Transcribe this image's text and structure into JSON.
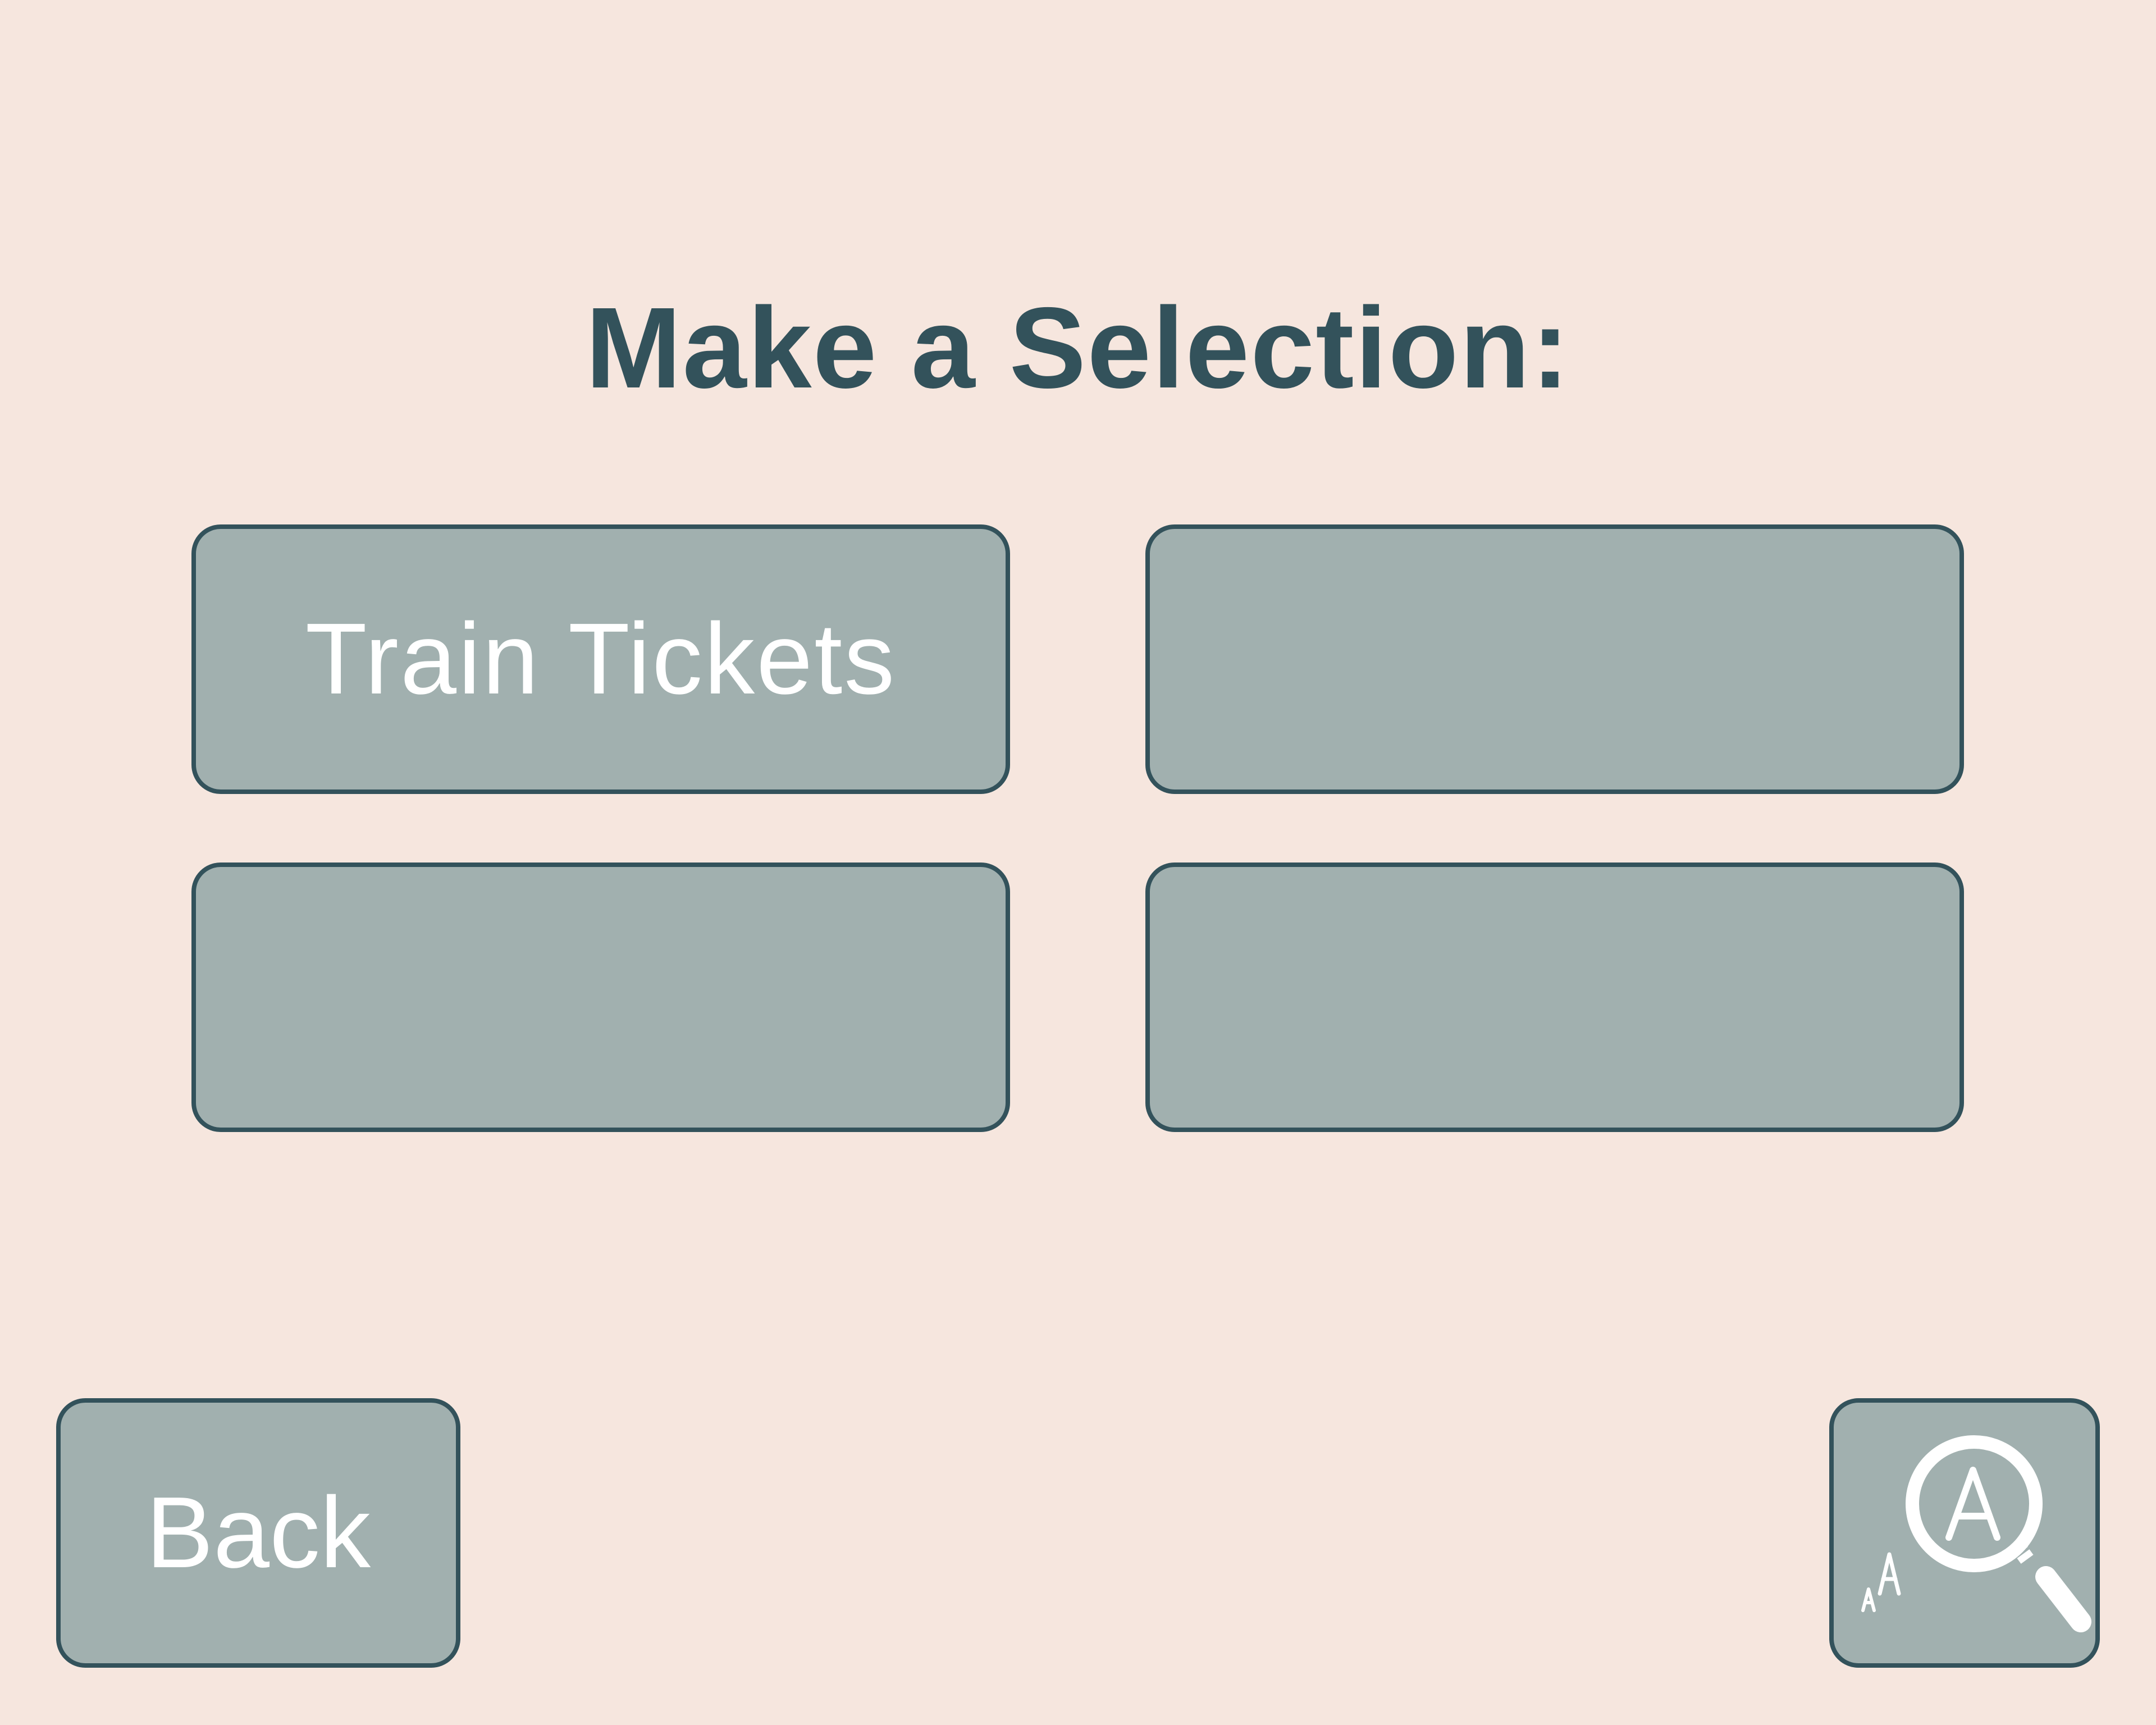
{
  "screen": {
    "title": "Make a Selection:"
  },
  "options": [
    {
      "label": "Train Tickets"
    },
    {
      "label": ""
    },
    {
      "label": ""
    },
    {
      "label": ""
    }
  ],
  "footer": {
    "back_label": "Back",
    "zoom_icon": "text-size-magnifier-icon"
  },
  "colors": {
    "background": "#f6e6de",
    "tile_fill": "#a1b0af",
    "border_and_title": "#33525b",
    "label_text": "#ffffff"
  }
}
